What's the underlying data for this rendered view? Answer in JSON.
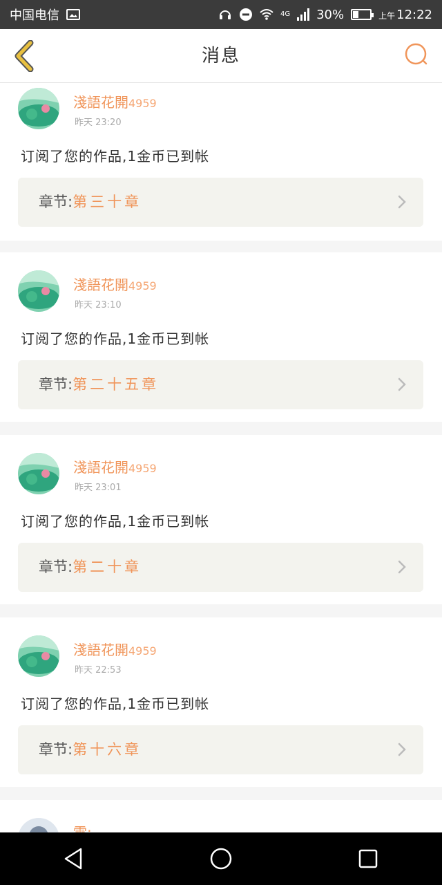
{
  "status_bar": {
    "carrier": "中国电信",
    "network": "4G",
    "battery": "30%",
    "am_pm": "上午",
    "time": "12:22"
  },
  "header": {
    "title": "消息",
    "back_icon": "chevron-left-icon",
    "search_icon": "search-icon"
  },
  "colors": {
    "accent": "#f0955a",
    "back_accent": "#e8c040",
    "chapter_bg": "#f3f3ee"
  },
  "messages": [
    {
      "user": "淺語花開",
      "user_num": "4959",
      "time": "昨天 23:20",
      "text": "订阅了您的作品,1金币已到帐",
      "chapter_label": "章节:",
      "chapter": "第三十章"
    },
    {
      "user": "淺語花開",
      "user_num": "4959",
      "time": "昨天 23:10",
      "text": "订阅了您的作品,1金币已到帐",
      "chapter_label": "章节:",
      "chapter": "第二十五章"
    },
    {
      "user": "淺語花開",
      "user_num": "4959",
      "time": "昨天 23:01",
      "text": "订阅了您的作品,1金币已到帐",
      "chapter_label": "章节:",
      "chapter": "第二十章"
    },
    {
      "user": "淺語花開",
      "user_num": "4959",
      "time": "昨天 22:53",
      "text": "订阅了您的作品,1金币已到帐",
      "chapter_label": "章节:",
      "chapter": "第十六章"
    },
    {
      "user": "雪:"
    }
  ],
  "nav": {
    "back": "triangle-back-icon",
    "home": "circle-home-icon",
    "recents": "square-recents-icon"
  }
}
